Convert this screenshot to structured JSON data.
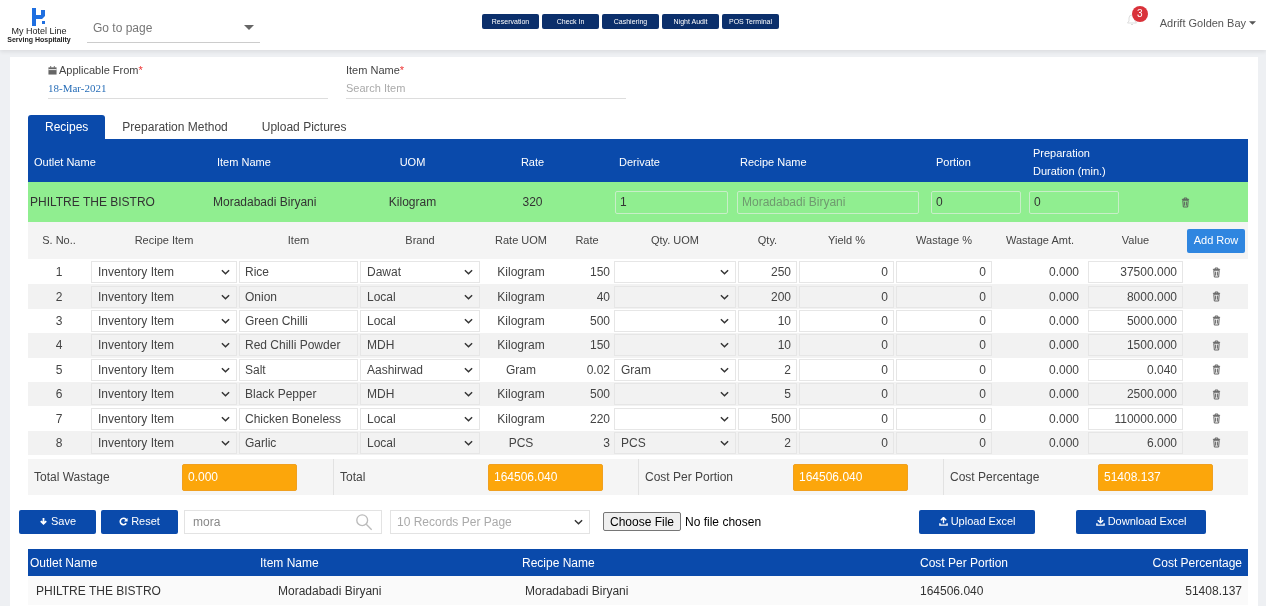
{
  "header": {
    "logo": {
      "name": "My Hotel Line",
      "tagline": "Serving Hospitality"
    },
    "go_to_page": {
      "placeholder": "Go to page"
    },
    "nav_buttons": [
      "Reservation",
      "Check In",
      "Cashiering",
      "Night Audit",
      "POS Terminal"
    ],
    "notification_count": "3",
    "user": "Adrift Golden Bay"
  },
  "form": {
    "applicable_from": {
      "label": "Applicable From",
      "required_mark": "*",
      "value": "18-Mar-2021"
    },
    "item_name": {
      "label": "Item Name",
      "required_mark": "*",
      "placeholder": "Search Item"
    }
  },
  "tabs": [
    {
      "label": "Recipes",
      "selected": true
    },
    {
      "label": "Preparation Method",
      "selected": false
    },
    {
      "label": "Upload Pictures",
      "selected": false
    }
  ],
  "recipe": {
    "columns": [
      "Outlet Name",
      "Item Name",
      "UOM",
      "Rate",
      "Derivate",
      "Recipe Name",
      "Portion",
      "Preparation Duration (min.)"
    ],
    "row": {
      "outlet_name": "PHILTRE THE BISTRO",
      "item_name": "Moradabadi Biryani",
      "uom": "Kilogram",
      "rate": "320",
      "derivate": "1",
      "recipe_name_placeholder": "Moradabadi Biryani",
      "portion": "0",
      "preparation_duration": "0"
    }
  },
  "items": {
    "columns": [
      "S. No..",
      "Recipe Item",
      "Item",
      "Brand",
      "Rate UOM",
      "Rate",
      "Qty. UOM",
      "Qty.",
      "Yield %",
      "Wastage %",
      "Wastage Amt.",
      "Value"
    ],
    "add_row_button": "Add Row",
    "rows": [
      {
        "s_no": "1",
        "recipe_item": "Inventory Item",
        "item": "Rice",
        "brand": "Dawat",
        "rate_uom": "Kilogram",
        "rate": "150",
        "qty": "250",
        "yield": "0",
        "wastage_pct": "0",
        "wastage_amt": "0.000",
        "value": "37500.000"
      },
      {
        "s_no": "2",
        "recipe_item": "Inventory Item",
        "item": "Onion",
        "brand": "Local",
        "rate_uom": "Kilogram",
        "rate": "40",
        "qty": "200",
        "yield": "0",
        "wastage_pct": "0",
        "wastage_amt": "0.000",
        "value": "8000.000"
      },
      {
        "s_no": "3",
        "recipe_item": "Inventory Item",
        "item": "Green Chilli",
        "brand": "Local",
        "rate_uom": "Kilogram",
        "rate": "500",
        "qty": "10",
        "yield": "0",
        "wastage_pct": "0",
        "wastage_amt": "0.000",
        "value": "5000.000"
      },
      {
        "s_no": "4",
        "recipe_item": "Inventory Item",
        "item": "Red Chilli Powder",
        "brand": "MDH",
        "rate_uom": "Kilogram",
        "rate": "150",
        "qty": "10",
        "yield": "0",
        "wastage_pct": "0",
        "wastage_amt": "0.000",
        "value": "1500.000"
      },
      {
        "s_no": "5",
        "recipe_item": "Inventory Item",
        "item": "Salt",
        "brand": "Aashirwad",
        "rate_uom": "Gram",
        "rate": "0.02",
        "qty_uom": "Gram",
        "qty": "2",
        "yield": "0",
        "wastage_pct": "0",
        "wastage_amt": "0.000",
        "value": "0.040"
      },
      {
        "s_no": "6",
        "recipe_item": "Inventory Item",
        "item": "Black Pepper",
        "brand": "MDH",
        "rate_uom": "Kilogram",
        "rate": "500",
        "qty": "5",
        "yield": "0",
        "wastage_pct": "0",
        "wastage_amt": "0.000",
        "value": "2500.000"
      },
      {
        "s_no": "7",
        "recipe_item": "Inventory Item",
        "item": "Chicken Boneless",
        "brand": "Local",
        "rate_uom": "Kilogram",
        "rate": "220",
        "qty": "500",
        "yield": "0",
        "wastage_pct": "0",
        "wastage_amt": "0.000",
        "value": "110000.000"
      },
      {
        "s_no": "8",
        "recipe_item": "Inventory Item",
        "item": "Garlic",
        "brand": "Local",
        "rate_uom": "PCS",
        "rate": "3",
        "qty_uom": "PCS",
        "qty": "2",
        "yield": "0",
        "wastage_pct": "0",
        "wastage_amt": "0.000",
        "value": "6.000"
      }
    ]
  },
  "totals": [
    {
      "label": "Total Wastage",
      "value": "0.000"
    },
    {
      "label": "Total",
      "value": "164506.040"
    },
    {
      "label": "Cost Per Portion",
      "value": "164506.040"
    },
    {
      "label": "Cost Percentage",
      "value": "51408.137"
    }
  ],
  "toolbar": {
    "save": "Save",
    "reset": "Reset",
    "search_value": "mora",
    "records_per_page": "10 Records Per Page",
    "file_button": "Choose File",
    "file_status": "No file chosen",
    "upload": "Upload Excel",
    "download": "Download Excel"
  },
  "list": {
    "columns": [
      "Outlet Name",
      "Item Name",
      "Recipe Name",
      "Cost Per Portion",
      "Cost Percentage"
    ],
    "rows": [
      [
        "PHILTRE THE BISTRO",
        "Moradabadi Biryani",
        "Moradabadi Biryani",
        "164506.040",
        "51408.137"
      ]
    ]
  }
}
